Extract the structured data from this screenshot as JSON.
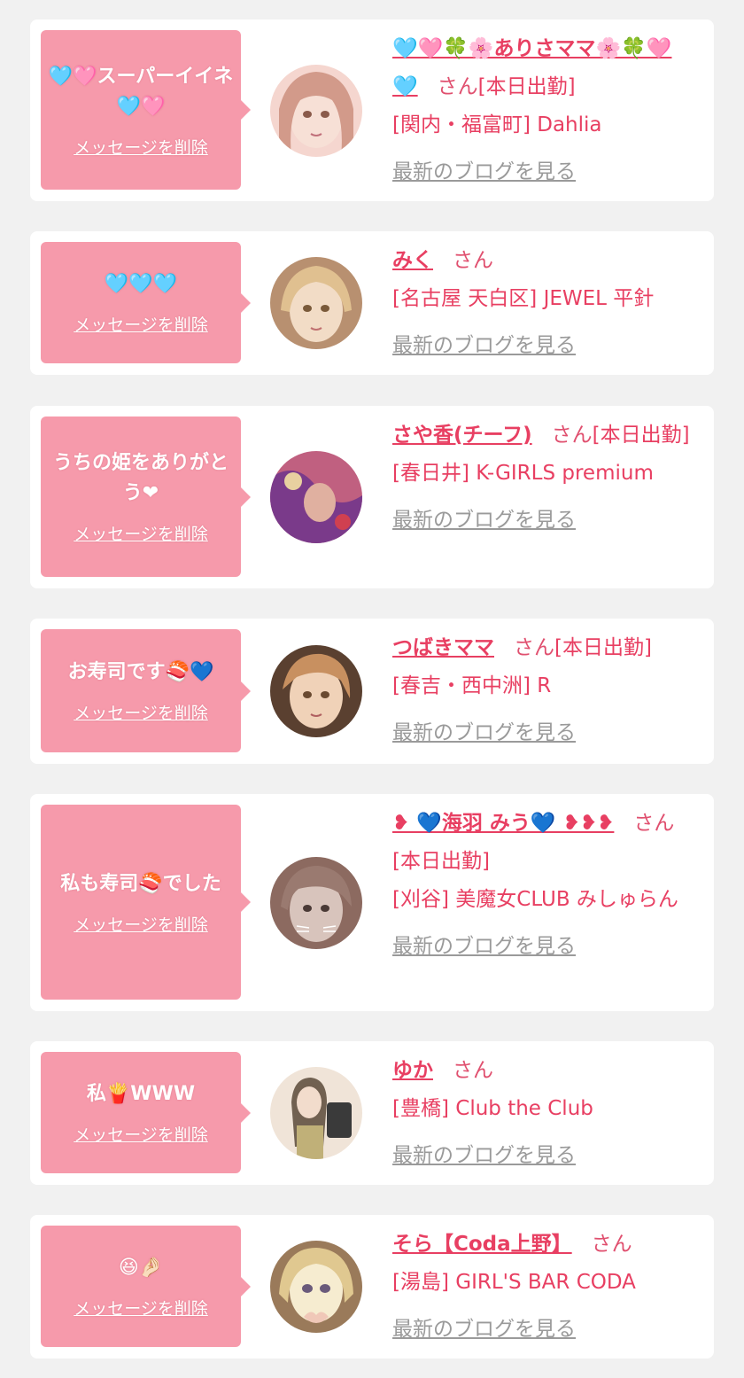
{
  "entries": [
    {
      "message": "🩵🩷スーパーイイネ🩵🩷",
      "delete_label": "メッセージを削除",
      "name": "🩵🩷🍀🌸ありさママ🌸🍀🩷🩵",
      "honorific": "さん",
      "status": "[本日出勤]",
      "shop": "[関内・福富町] Dahlia",
      "blog_link": "最新のブログを見る",
      "avatar_colors": [
        "#f5d6cf",
        "#d29a8a",
        "#8a5a4a"
      ]
    },
    {
      "message": "🩵🩵🩵",
      "delete_label": "メッセージを削除",
      "name": "みく",
      "honorific": "さん",
      "status": "",
      "shop": "[名古屋 天白区] JEWEL 平針",
      "blog_link": "最新のブログを見る",
      "avatar_colors": [
        "#f2dcc6",
        "#c8a070",
        "#7a5a3a"
      ]
    },
    {
      "message": "うちの姫をありがとう❤",
      "delete_label": "メッセージを削除",
      "name": "さや香(チーフ)",
      "honorific": "さん",
      "status": "[本日出勤]",
      "shop": "[春日井] K-GIRLS premium",
      "blog_link": "最新のブログを見る",
      "avatar_colors": [
        "#c06080",
        "#7a3a8a",
        "#e0b0a0"
      ]
    },
    {
      "message": "お寿司です🍣💙",
      "delete_label": "メッセージを削除",
      "name": "つばきママ",
      "honorific": "さん",
      "status": "[本日出勤]",
      "shop": "[春吉・西中洲] R",
      "blog_link": "最新のブログを見る",
      "avatar_colors": [
        "#f0d2b8",
        "#c89060",
        "#6a4a30"
      ]
    },
    {
      "message": "私も寿司🍣でした",
      "delete_label": "メッセージを削除",
      "name": "❥ 💙海羽 みう💙 ❥❥❥",
      "honorific": "さん",
      "status": "[本日出勤]",
      "shop": "[刈谷] 美魔女CLUB みしゅらん",
      "blog_link": "最新のブログを見る",
      "avatar_colors": [
        "#d8c4bc",
        "#8c6a60",
        "#4a3a36"
      ]
    },
    {
      "message": "私🍟WWW",
      "delete_label": "メッセージを削除",
      "name": "ゆか",
      "honorific": "さん",
      "status": "",
      "shop": "[豊橋] Club the Club",
      "blog_link": "最新のブログを見る",
      "avatar_colors": [
        "#f0e4d8",
        "#c0b078",
        "#5a4a3a"
      ]
    },
    {
      "message": "😆🤌🏻",
      "delete_label": "メッセージを削除",
      "name": "そら【Coda上野】",
      "honorific": "さん",
      "status": "",
      "shop": "[湯島] GIRL'S BAR CODA",
      "blog_link": "最新のブログを見る",
      "avatar_colors": [
        "#f6ecd0",
        "#e0c890",
        "#9a7a5a"
      ]
    }
  ]
}
